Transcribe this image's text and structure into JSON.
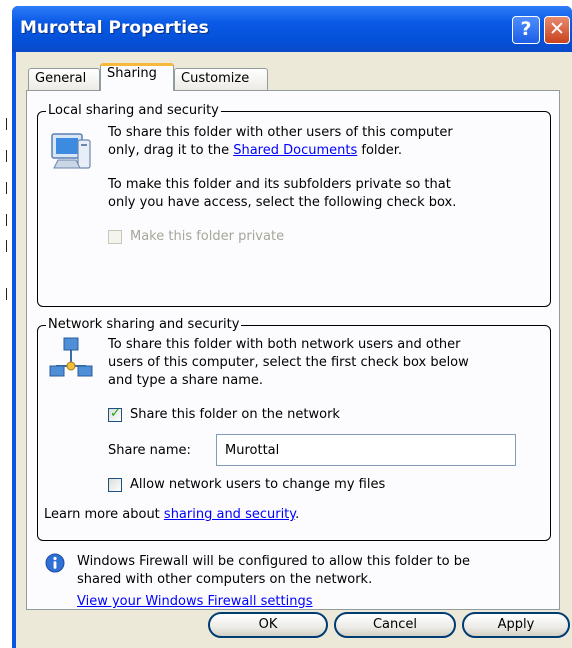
{
  "window": {
    "title": "Murottal Properties",
    "help_glyph": "?",
    "close_glyph": "✕"
  },
  "tabs": [
    {
      "label": "General"
    },
    {
      "label": "Sharing",
      "active": true
    },
    {
      "label": "Customize"
    }
  ],
  "local": {
    "legend": "Local sharing and security",
    "text1_a": "To share this folder with other users of this computer",
    "text1_b": "only, drag it to the",
    "text1_link": "Shared Documents",
    "text1_c": "folder.",
    "text2_a": "To make this folder and its subfolders private so that",
    "text2_b": "only you have access, select the following check box.",
    "private_label": "Make this folder private",
    "private_checked": false,
    "private_enabled": false
  },
  "network": {
    "legend": "Network sharing and security",
    "text_a": "To share this folder with both network users and other",
    "text_b": "users of this computer, select the first check box below",
    "text_c": "and type a share name.",
    "share_label": "Share this folder on the network",
    "share_checked": true,
    "share_name_label": "Share name:",
    "share_name_value": "Murottal",
    "allow_label": "Allow network users to change my files",
    "allow_checked": false,
    "learn_prefix": "Learn more about",
    "learn_link": "sharing and security",
    "learn_suffix": "."
  },
  "firewall": {
    "text_a": "Windows Firewall will be configured to allow this folder to be",
    "text_b": "shared with other computers on the network.",
    "link": "View your Windows Firewall settings"
  },
  "buttons": {
    "ok": "OK",
    "cancel": "Cancel",
    "apply": "Apply"
  },
  "colors": {
    "titlebar": "#0a54e3",
    "face": "#ece9d8",
    "link": "#0000ff",
    "tab_highlight": "#f7b83c"
  }
}
